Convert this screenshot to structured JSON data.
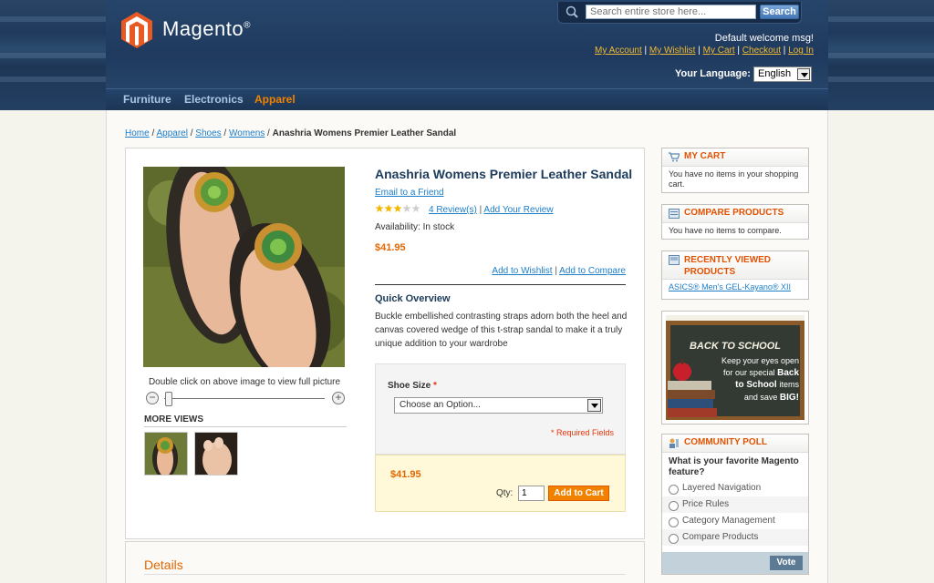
{
  "header": {
    "logo_text": "Magento",
    "logo_mark": "®",
    "search": {
      "placeholder": "Search entire store here...",
      "button": "Search"
    },
    "welcome": "Default welcome msg!",
    "links": [
      "My Account",
      "My Wishlist",
      "My Cart",
      "Checkout",
      "Log In"
    ],
    "language_label": "Your Language:",
    "language_value": "English"
  },
  "nav": {
    "items": [
      "Furniture",
      "Electronics",
      "Apparel"
    ],
    "active": "Apparel"
  },
  "breadcrumb": {
    "links": [
      "Home",
      "Apparel",
      "Shoes",
      "Womens"
    ],
    "current": "Anashria Womens Premier Leather Sandal"
  },
  "product": {
    "name": "Anashria Womens Premier Leather Sandal",
    "email_friend": "Email to a Friend",
    "rating_stars": 3,
    "reviews_link": "4 Review(s)",
    "add_review": "Add Your Review",
    "availability": "Availability: In stock",
    "price": "$41.95",
    "add_to_wishlist": "Add to Wishlist",
    "add_to_compare": "Add to Compare",
    "overview_title": "Quick Overview",
    "overview_text": "Buckle embellished contrasting straps adorn both the heel and canvas covered wedge of this t-strap sandal to make it a truly unique addition to your wardrobe",
    "zoom_hint": "Double click on above image to view full picture",
    "more_views": "MORE VIEWS",
    "shoe_size_label": "Shoe Size",
    "shoe_size_required_mark": "*",
    "shoe_size_value": "Choose an Option...",
    "required_fields": "* Required Fields",
    "cart_price": "$41.95",
    "qty_label": "Qty:",
    "qty_value": "1",
    "add_to_cart": "Add to Cart",
    "details_title": "Details"
  },
  "sidebar": {
    "cart": {
      "title": "MY CART",
      "text": "You have no items in your shopping cart."
    },
    "compare": {
      "title": "COMPARE PRODUCTS",
      "text": "You have no items to compare."
    },
    "recent": {
      "title": "RECENTLY VIEWED PRODUCTS",
      "item": "ASICS® Men's GEL-Kayano® XII"
    },
    "banner": {
      "title": "BACK TO SCHOOL",
      "line1": "Keep your eyes open",
      "line2": "for our special",
      "line2b": "Back",
      "line3": "to School",
      "line3b": "items",
      "line4": "and save",
      "line4b": "BIG!"
    },
    "poll": {
      "title": "COMMUNITY POLL",
      "question": "What is your favorite Magento feature?",
      "options": [
        "Layered Navigation",
        "Price Rules",
        "Category Management",
        "Compare Products"
      ],
      "vote": "Vote"
    }
  },
  "colors": {
    "accent": "#f18200",
    "link": "#1e7ec8",
    "header": "#1f3a5c",
    "price": "#e26703"
  }
}
